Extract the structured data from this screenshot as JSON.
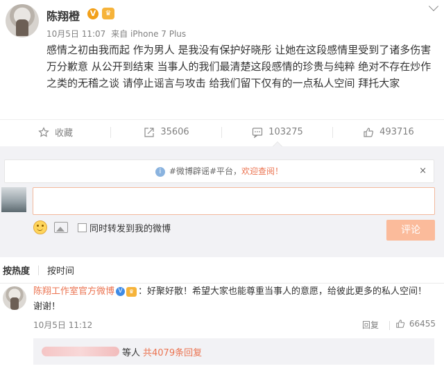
{
  "post": {
    "author": "陈翔橙",
    "verified_badge": "V",
    "meta_date": "10月5日 11:07",
    "meta_source": "来自 iPhone 7 Plus",
    "text": "感情之初由我而起 作为男人 是我没有保护好晓彤 让她在这段感情里受到了诸多伤害 万分歉意 从公开到结束 当事人的我们最清楚这段感情的珍贵与纯粹 绝对不存在炒作之类的无稽之谈 请停止谣言与攻击 给我们留下仅有的一点私人空间 拜托大家"
  },
  "actions": {
    "favorite": "收藏",
    "repost": "35606",
    "comment": "103275",
    "like": "493716"
  },
  "comment_box": {
    "notice_prefix": "#微博辟谣#平台，",
    "notice_link": "欢迎查阅！",
    "notice_close": "×",
    "forward_label": "同时转发到我的微博",
    "submit": "评论"
  },
  "sort": {
    "hot": "按热度",
    "time": "按时间"
  },
  "top_comment": {
    "author": "陈翔工作室官方微博",
    "verified_badge": "V",
    "text": "：好聚好散！希望大家也能尊重当事人的意愿，给彼此更多的私人空间！谢谢！",
    "date": "10月5日 11:12",
    "reply": "回复",
    "likes": "66455",
    "replies_who": "等人",
    "replies_count": "共4079条回复"
  },
  "colors": {
    "accent": "#eb7350",
    "submit_disabled": "#fbbb9b",
    "panel_bg": "#f2f2f5"
  }
}
